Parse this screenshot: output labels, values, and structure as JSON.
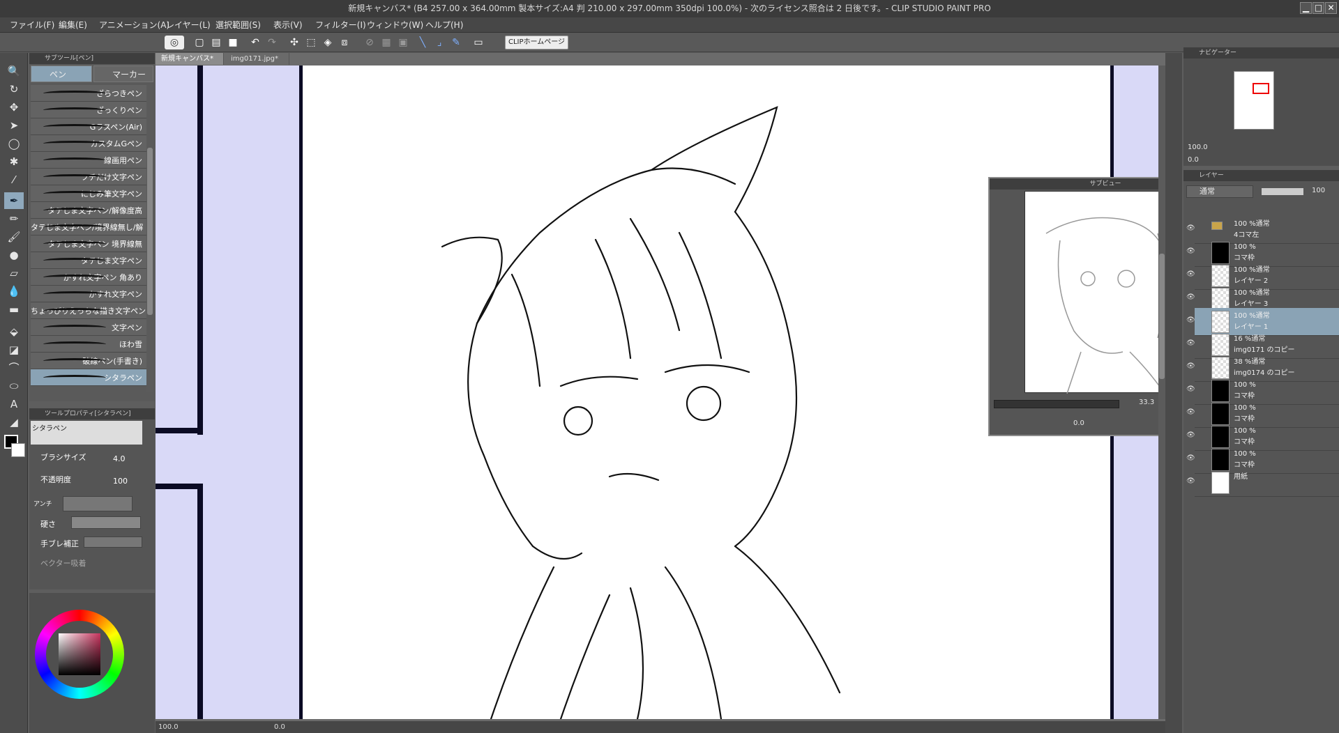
{
  "window": {
    "title": "新規キャンバス* (B4 257.00 x 364.00mm 製本サイズ:A4 判 210.00 x 297.00mm 350dpi 100.0%)  - 次のライセンス照合は 2 日後です。- CLIP STUDIO PAINT PRO",
    "min": "▁",
    "max": "□",
    "close": "✕"
  },
  "menu": [
    "ファイル(F)",
    "編集(E)",
    "アニメーション(A)",
    "レイヤー(L)",
    "選択範囲(S)",
    "表示(V)",
    "フィルター(I)",
    "ウィンドウ(W)",
    "ヘルプ(H)"
  ],
  "commandbar": {
    "home_button": "CLIPホームページ"
  },
  "subtool": {
    "header": "サブツール[ペン]",
    "tab_pen": "ペン",
    "tab_marker": "マーカー",
    "brushes": [
      "ざらつきペン",
      "ざっくりペン",
      "Gラスペン(Air)",
      "カスタムGペン",
      "線画用ペン",
      "フチだけ文字ペン",
      "にじみ筆文字ペン",
      "タテじま文字ペン/解像度高",
      "タテじま文字ペン/境界線無し/解",
      "タテじま文字ペン 境界線無",
      "タテじま文字ペン",
      "かすれ文字ペン 角あり",
      "かすれ文字ペン",
      "ちょっぴりえっちな描き文字ペン",
      "文字ペン",
      "ほわ雪",
      "破線ペン(手書き)",
      "シタラペン"
    ],
    "selected": "シタラペン"
  },
  "toolprop": {
    "header": "ツールプロパティ[シタラペン]",
    "preset_name": "シタラペン",
    "brush_size_label": "ブラシサイズ",
    "brush_size": "4.0",
    "opacity_label": "不透明度",
    "opacity": "100",
    "antialias_label": "アンチ",
    "hardness_label": "硬さ",
    "stabilizer_label": "手ブレ補正",
    "vector_label": "ベクター吸着"
  },
  "canvas": {
    "tabs": [
      "新規キャンバス*",
      "img0171.jpg*"
    ],
    "zoom": "100.0",
    "angle": "0.0"
  },
  "subview": {
    "title": "サブビュー",
    "zoom": "33.3",
    "angle": "0.0"
  },
  "navigator": {
    "header": "ナビゲーター",
    "zoom": "100.0",
    "angle": "0.0"
  },
  "layers": {
    "header": "レイヤー",
    "blend": "通常",
    "opacity": "100",
    "items": [
      {
        "line1": "100 %通常",
        "line2": "4コマ左",
        "type": "folder"
      },
      {
        "line1": "100 %",
        "line2": "コマ枠",
        "type": "frame"
      },
      {
        "line1": "100 %通常",
        "line2": "レイヤー 2",
        "type": "raster"
      },
      {
        "line1": "100 %通常",
        "line2": "レイヤー 3",
        "type": "raster"
      },
      {
        "line1": "100 %通常",
        "line2": "レイヤー 1",
        "type": "raster",
        "selected": true
      },
      {
        "line1": "16 %通常",
        "line2": "img0171 のコピー",
        "type": "raster"
      },
      {
        "line1": "38 %通常",
        "line2": "img0174 のコピー",
        "type": "raster"
      },
      {
        "line1": "100 %",
        "line2": "コマ枠",
        "type": "frame"
      },
      {
        "line1": "100 %",
        "line2": "コマ枠",
        "type": "frame"
      },
      {
        "line1": "100 %",
        "line2": "コマ枠",
        "type": "frame"
      },
      {
        "line1": "100 %",
        "line2": "コマ枠",
        "type": "frame"
      },
      {
        "line1": "",
        "line2": "用紙",
        "type": "paper"
      }
    ]
  },
  "colors": {
    "accent": "#8aa3b5",
    "stage": "#d9d9f7",
    "frame": "#0b0b24"
  }
}
